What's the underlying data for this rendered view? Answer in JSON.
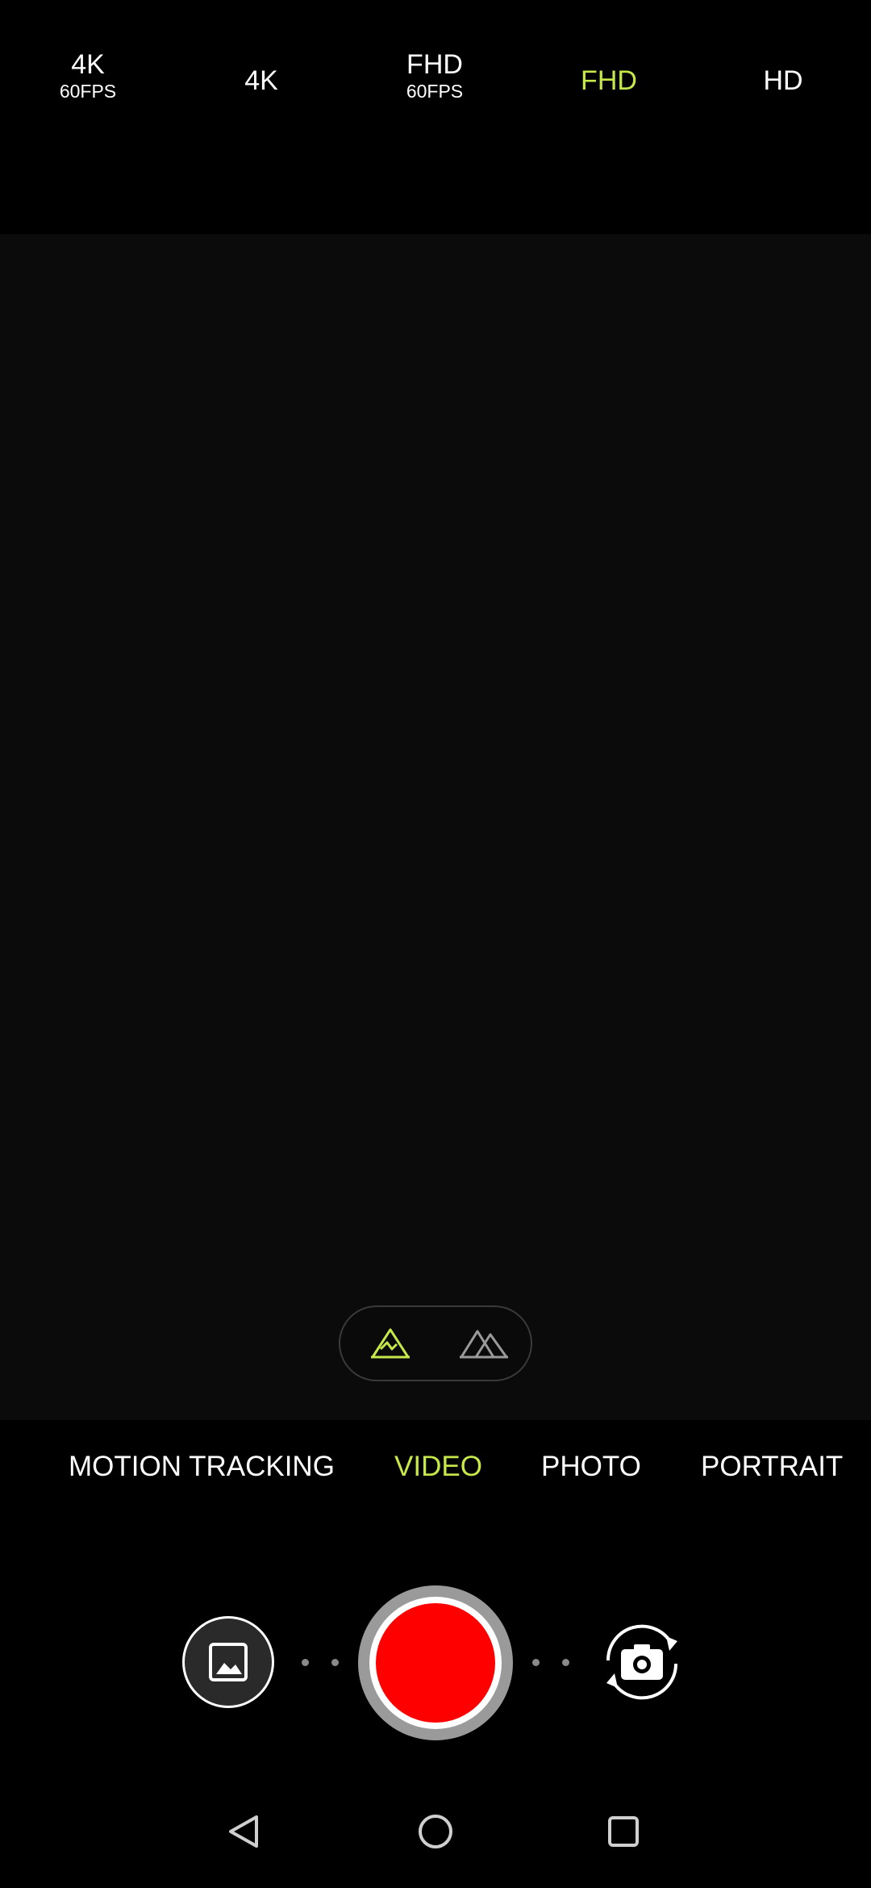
{
  "resolution_bar": {
    "items": [
      {
        "label": "4K",
        "sub": "60FPS",
        "selected": false
      },
      {
        "label": "4K",
        "sub": "",
        "selected": false
      },
      {
        "label": "FHD",
        "sub": "60FPS",
        "selected": false
      },
      {
        "label": "FHD",
        "sub": "",
        "selected": true
      },
      {
        "label": "HD",
        "sub": "",
        "selected": false
      }
    ]
  },
  "lens_toggle": {
    "options": [
      {
        "icon": "mountain-single-icon",
        "selected": true
      },
      {
        "icon": "mountains-wide-icon",
        "selected": false
      }
    ]
  },
  "modes": {
    "items": [
      {
        "label": "MOTION TRACKING",
        "selected": false
      },
      {
        "label": "VIDEO",
        "selected": true
      },
      {
        "label": "PHOTO",
        "selected": false
      },
      {
        "label": "PORTRAIT",
        "selected": false
      }
    ]
  },
  "controls": {
    "gallery_icon": "image-icon",
    "shutter_icon": "record-button",
    "switch_icon": "camera-switch-icon"
  },
  "nav": {
    "back_icon": "back-triangle-icon",
    "home_icon": "home-circle-icon",
    "recents_icon": "recents-square-icon"
  },
  "colors": {
    "accent": "#c6e84a",
    "record": "#ff0000",
    "background": "#000000",
    "viewfinder": "#0b0b0b"
  }
}
